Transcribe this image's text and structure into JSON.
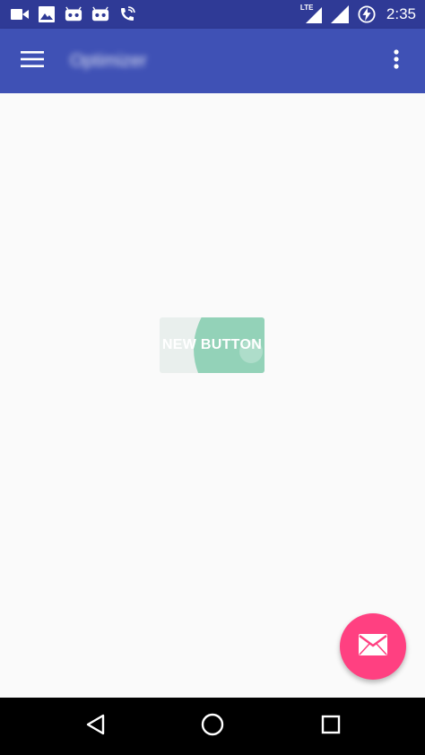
{
  "status_bar": {
    "network_label": "LTE",
    "time": "2:35",
    "icons": [
      "video-camera-icon",
      "image-icon",
      "android-debug-icon",
      "android-debug-icon",
      "wifi-calling-icon",
      "signal-lte-icon",
      "signal-icon",
      "battery-charging-icon"
    ]
  },
  "app_bar": {
    "title": "Optimizer",
    "menu_icon": "hamburger-menu-icon",
    "overflow_icon": "more-vert-icon",
    "color": "#3f51b5"
  },
  "content": {
    "new_button_label": "NEW BUTTON",
    "new_button_color": "#93d2b8"
  },
  "fab": {
    "icon": "email-icon",
    "color": "#ff4081"
  },
  "nav_bar": {
    "icons": [
      "back-icon",
      "home-icon",
      "recents-icon"
    ]
  }
}
